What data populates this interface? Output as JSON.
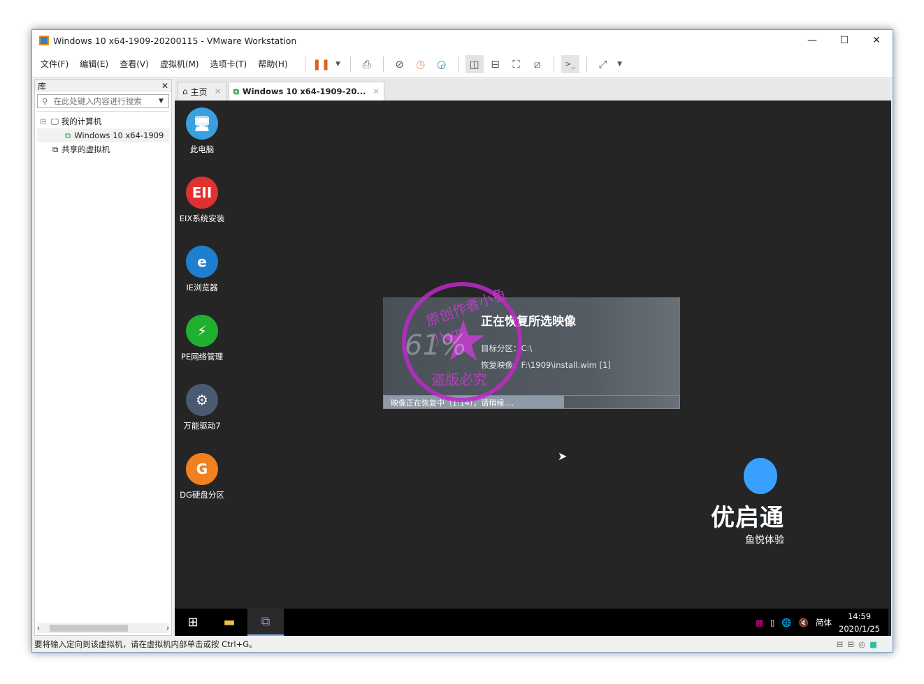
{
  "window": {
    "title": "Windows 10 x64-1909-20200115 - VMware Workstation",
    "controls": [
      "—",
      "☐",
      "✕"
    ]
  },
  "menu": [
    "文件(F)",
    "编辑(E)",
    "查看(V)",
    "虚拟机(M)",
    "选项卡(T)",
    "帮助(H)"
  ],
  "library": {
    "title": "库",
    "close": "✕",
    "search_placeholder": "在此处键入内容进行搜索",
    "tree": [
      {
        "label": "我的计算机",
        "toggle": "⊟"
      },
      {
        "label": "Windows 10 x64-1909"
      },
      {
        "label": "共享的虚拟机"
      }
    ]
  },
  "tabs": [
    {
      "label": "主页",
      "icon": "home-icon"
    },
    {
      "label": "Windows 10 x64-1909-20...",
      "icon": "vm-icon"
    }
  ],
  "desktop": {
    "icons": [
      {
        "label": "此电脑",
        "glyph": "🖥",
        "color": "#3aa0e0"
      },
      {
        "label": "EIX系统安装",
        "glyph": "EII",
        "color": "#e03030"
      },
      {
        "label": "IE浏览器",
        "glyph": "e",
        "color": "#1e7fd0"
      },
      {
        "label": "PE网络管理",
        "glyph": "⚡",
        "color": "#20b030"
      },
      {
        "label": "万能驱动7",
        "glyph": "⚙",
        "color": "#4a5a70"
      },
      {
        "label": "DG硬盘分区",
        "glyph": "G",
        "color": "#f08020"
      }
    ]
  },
  "dialog": {
    "title": "正在恢复所选映像",
    "target_label": "目标分区：",
    "target_value": "C:\\",
    "image_label": "恢复映像：",
    "image_value": "F:\\1909\\install.wim [1]",
    "progress_text": "映像正在恢复中（1:14），请稍候....",
    "progress_percent": 61
  },
  "stamp": {
    "top": "原创作者小鱼儿yr",
    "bottom": "盗版必究",
    "percent": "61%"
  },
  "logo": {
    "name": "优启通",
    "slogan": "鱼悦体验",
    "accent": "#3aa0ff"
  },
  "taskbar": {
    "ime": "简体",
    "time": "14:59",
    "date": "2020/1/25"
  },
  "statusbar": {
    "text": "要将输入定向到该虚拟机，请在虚拟机内部单击或按 Ctrl+G。"
  }
}
